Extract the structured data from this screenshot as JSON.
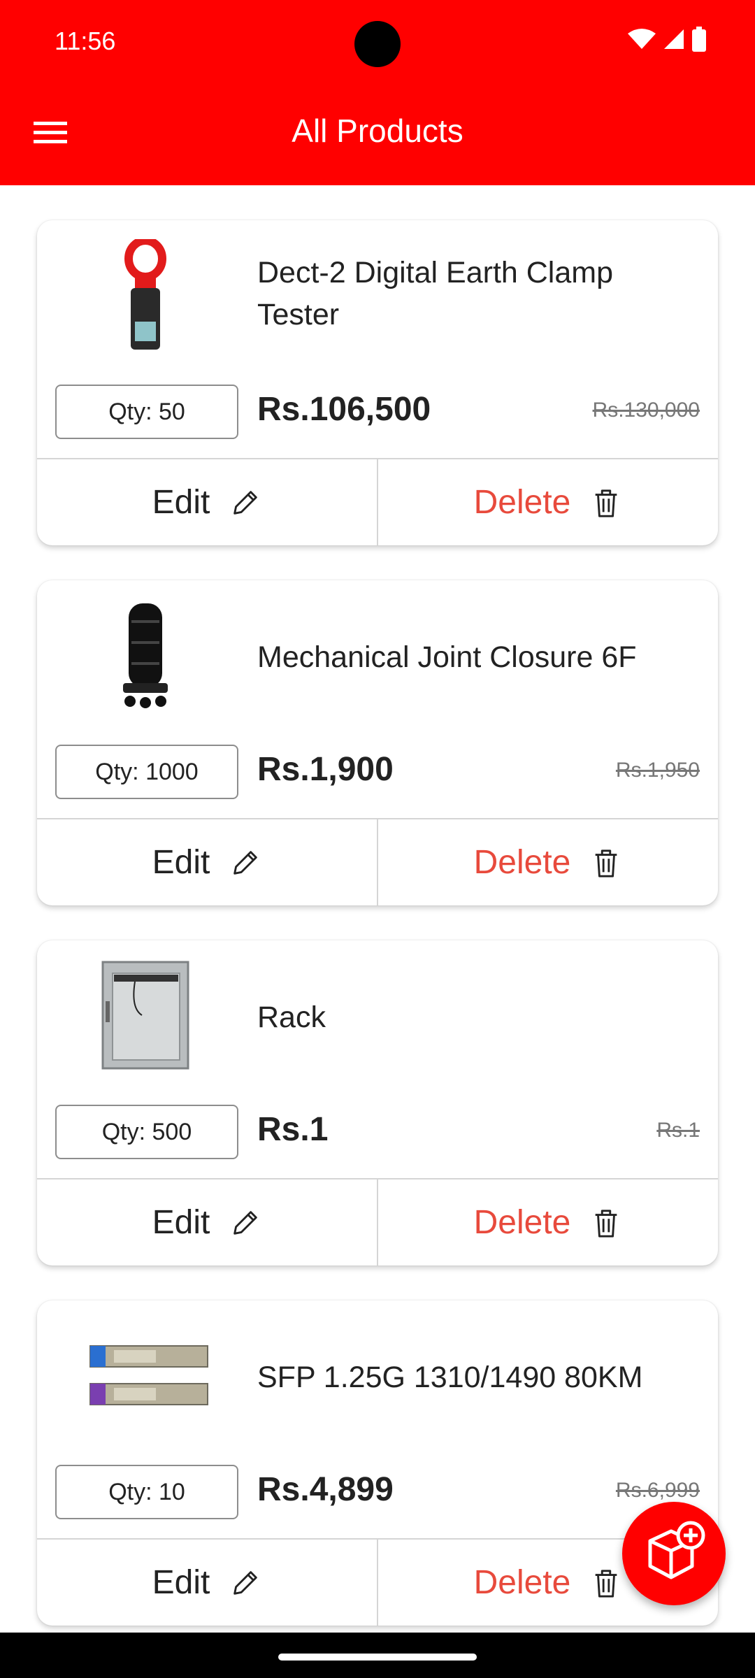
{
  "status": {
    "time": "11:56"
  },
  "appbar": {
    "title": "All Products",
    "menu_icon": "hamburger-menu-icon"
  },
  "products": [
    {
      "name": "Dect-2 Digital Earth Clamp Tester",
      "qty": "Qty: 50",
      "price": "Rs.106,500",
      "old_price": "Rs.130,000",
      "edit": "Edit",
      "delete": "Delete"
    },
    {
      "name": "Mechanical Joint Closure 6F",
      "qty": "Qty: 1000",
      "price": "Rs.1,900",
      "old_price": "Rs.1,950",
      "edit": "Edit",
      "delete": "Delete"
    },
    {
      "name": "Rack",
      "qty": "Qty: 500",
      "price": "Rs.1",
      "old_price": "Rs.1",
      "edit": "Edit",
      "delete": "Delete"
    },
    {
      "name": "SFP 1.25G 1310/1490 80KM",
      "qty": "Qty: 10",
      "price": "Rs.4,899",
      "old_price": "Rs.6,999",
      "edit": "Edit",
      "delete": "Delete"
    }
  ],
  "fab": {
    "icon": "add-product-box-icon"
  },
  "colors": {
    "primary": "#ff0000",
    "delete": "#e84a3c"
  }
}
